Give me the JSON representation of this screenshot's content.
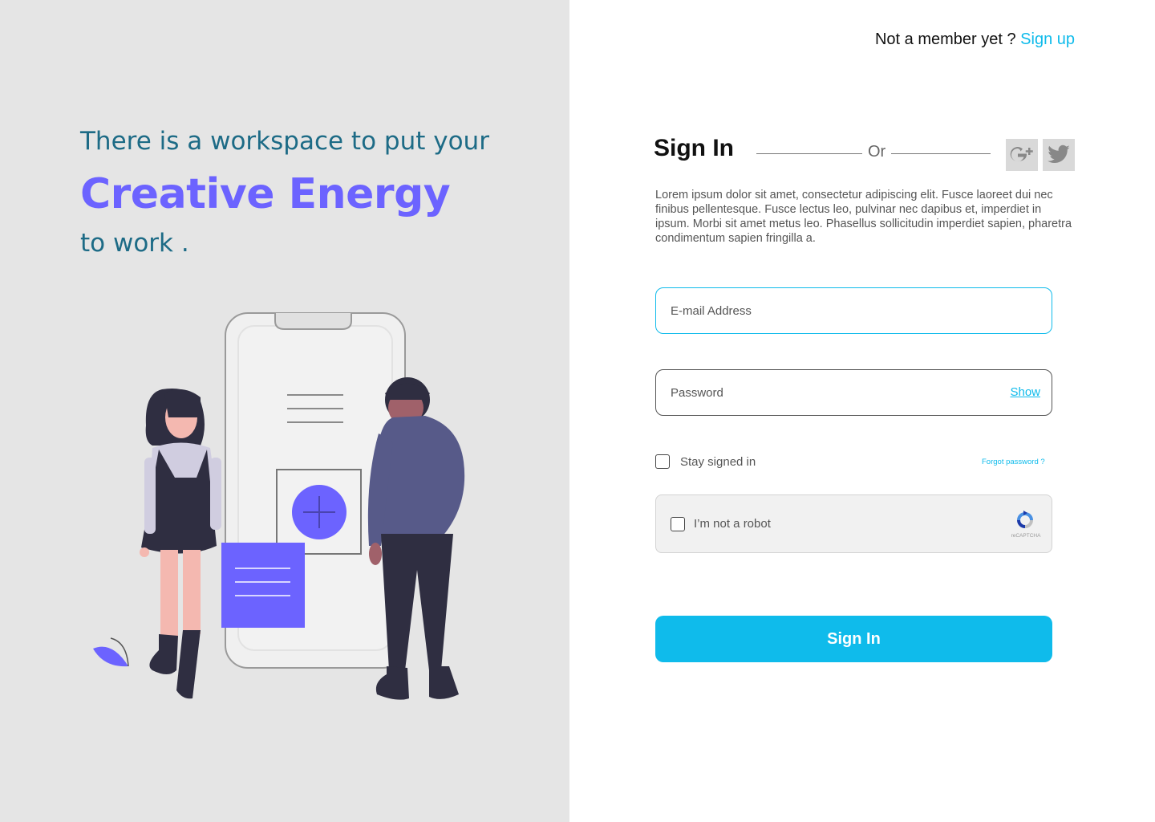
{
  "hero": {
    "line1": "There is a workspace to put your",
    "line2": "Creative Energy",
    "line3": "to work ."
  },
  "header": {
    "member_prompt": "Not a member yet ? ",
    "signup_link": "Sign up"
  },
  "form": {
    "title": "Sign In",
    "or_text": "Or",
    "description": "Lorem ipsum dolor sit amet, consectetur adipiscing elit. Fusce laoreet dui nec finibus pellentesque. Fusce lectus leo, pulvinar nec dapibus et, imperdiet in ipsum. Morbi sit amet metus leo. Phasellus sollicitudin imperdiet sapien, pharetra condimentum sapien fringilla a.",
    "email_placeholder": "E-mail Address",
    "password_placeholder": "Password",
    "show_label": "Show",
    "stay_signed_in": "Stay signed in",
    "forgot_password": "Forgot password ?",
    "captcha_label": "I’m not a robot",
    "captcha_brand": "reCAPTCHA",
    "submit_label": "Sign In"
  },
  "social": [
    {
      "icon": "google-plus-icon"
    },
    {
      "icon": "twitter-icon"
    }
  ],
  "colors": {
    "accent": "#0fbbeb",
    "brand_purple": "#6c63ff",
    "tagline_teal": "#1d6b86",
    "left_panel_bg": "#e5e5e5"
  }
}
